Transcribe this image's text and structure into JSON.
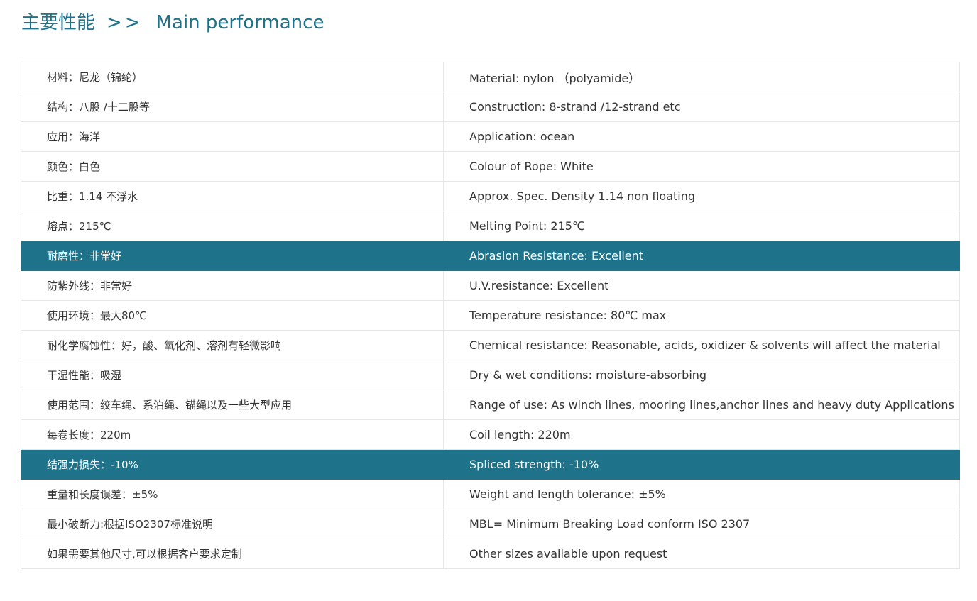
{
  "heading": {
    "cn": "主要性能",
    "sep": ">>",
    "en": "Main performance"
  },
  "accent_color": "#1e7289",
  "rows": [
    {
      "cn": "材料：尼龙（锦纶）",
      "en": "Material: nylon （polyamide）",
      "highlight": false
    },
    {
      "cn": "结构：八股 /十二股等",
      "en": "Construction: 8-strand /12-strand etc",
      "highlight": false
    },
    {
      "cn": "应用：海洋",
      "en": "Application: ocean",
      "highlight": false
    },
    {
      "cn": "颜色：白色",
      "en": "Colour of Rope: White",
      "highlight": false
    },
    {
      "cn": "比重：1.14  不浮水",
      "en": "Approx. Spec. Density 1.14 non floating",
      "highlight": false
    },
    {
      "cn": "熔点：215℃",
      "en": "Melting Point: 215℃",
      "highlight": false
    },
    {
      "cn": "耐磨性：非常好",
      "en": "Abrasion Resistance: Excellent",
      "highlight": true
    },
    {
      "cn": "防紫外线：非常好",
      "en": "U.V.resistance: Excellent",
      "highlight": false
    },
    {
      "cn": "使用环境：最大80℃",
      "en": "Temperature resistance: 80℃ max",
      "highlight": false
    },
    {
      "cn": "耐化学腐蚀性：好，酸、氧化剂、溶剂有轻微影响",
      "en": "Chemical resistance: Reasonable, acids, oxidizer & solvents will affect the material",
      "highlight": false
    },
    {
      "cn": "干湿性能：吸湿",
      "en": "Dry & wet conditions: moisture-absorbing",
      "highlight": false
    },
    {
      "cn": "使用范围：绞车绳、系泊绳、锚绳以及一些大型应用",
      "en": "Range of use: As winch lines, mooring lines,anchor lines and heavy duty Applications",
      "highlight": false
    },
    {
      "cn": "每卷长度：220m",
      "en": "Coil length: 220m",
      "highlight": false
    },
    {
      "cn": "结强力损失：-10%",
      "en": "Spliced strength: -10%",
      "highlight": true
    },
    {
      "cn": "重量和长度误差：±5%",
      "en": "Weight and length tolerance: ±5%",
      "highlight": false
    },
    {
      "cn": "最小破断力:根据ISO2307标准说明",
      "en": "MBL= Minimum Breaking Load conform ISO 2307",
      "highlight": false
    },
    {
      "cn": "如果需要其他尺寸,可以根据客户要求定制",
      "en": "Other sizes available upon request",
      "highlight": false
    }
  ]
}
